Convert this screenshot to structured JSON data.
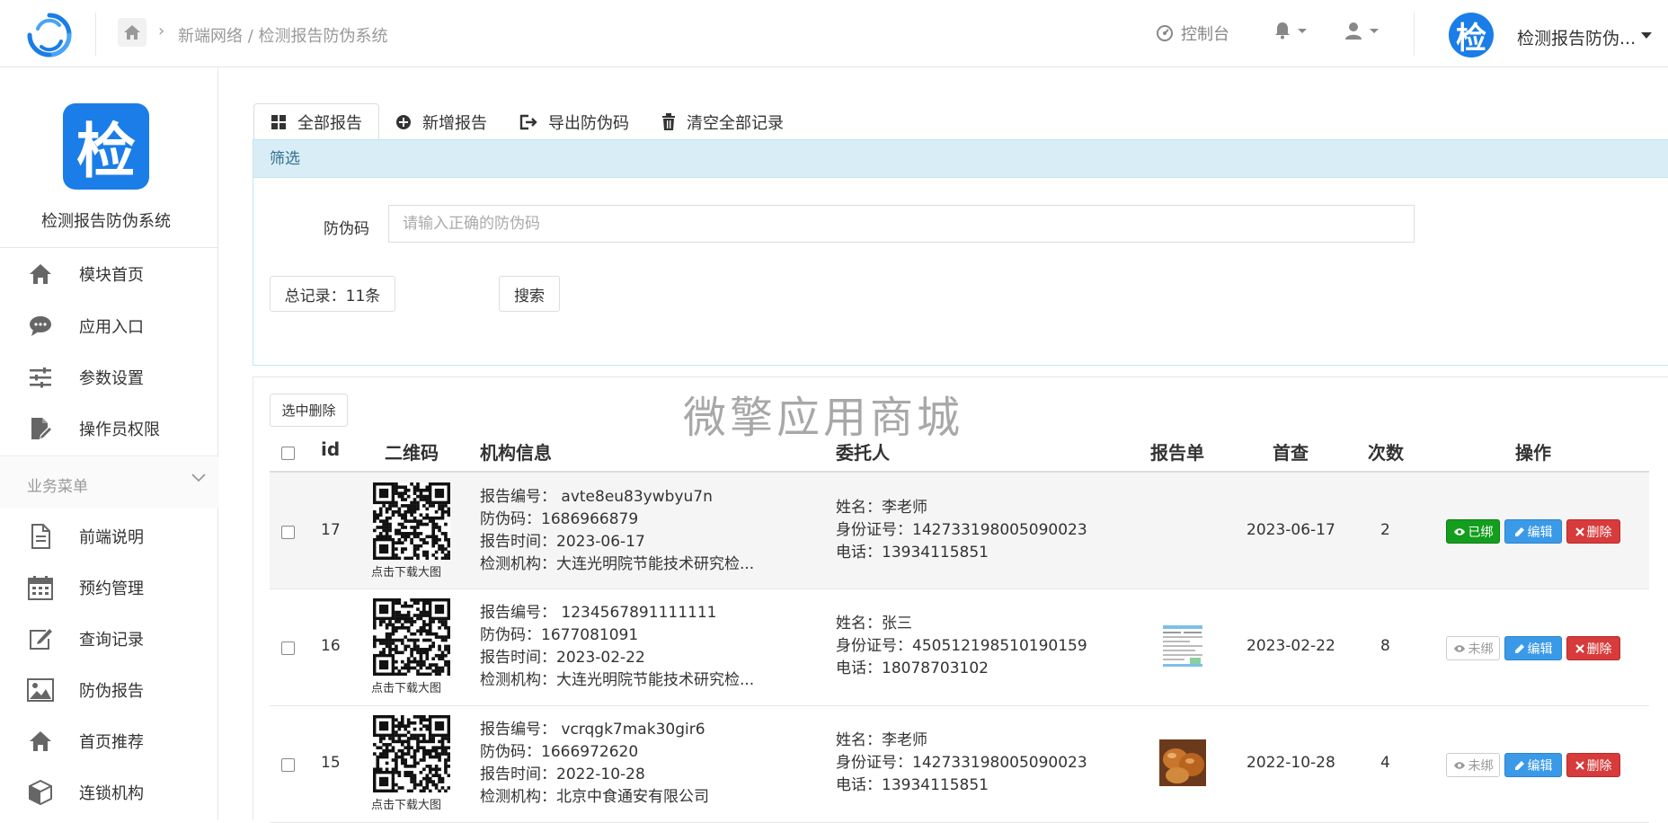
{
  "header": {
    "breadcrumb": "新端网络 / 检测报告防伪系统",
    "console_label": "控制台",
    "user_name": "检测报告防伪...",
    "avatar_glyph": "检"
  },
  "sidebar": {
    "logo_glyph": "检",
    "app_name": "检测报告防伪系统",
    "items": [
      {
        "label": "模块首页",
        "icon": "home-icon"
      },
      {
        "label": "应用入口",
        "icon": "chat-bubble-icon"
      },
      {
        "label": "参数设置",
        "icon": "sliders-icon"
      },
      {
        "label": "操作员权限",
        "icon": "edit-document-icon"
      }
    ],
    "group_label": "业务菜单",
    "group_items": [
      {
        "label": "前端说明",
        "icon": "document-icon"
      },
      {
        "label": "预约管理",
        "icon": "calendar-icon"
      },
      {
        "label": "查询记录",
        "icon": "pencil-square-icon"
      },
      {
        "label": "防伪报告",
        "icon": "image-icon"
      },
      {
        "label": "首页推荐",
        "icon": "home-icon"
      },
      {
        "label": "连锁机构",
        "icon": "cube-icon"
      }
    ]
  },
  "tabs": [
    {
      "label": "全部报告",
      "icon": "grid-icon"
    },
    {
      "label": "新增报告",
      "icon": "plus-circle-icon"
    },
    {
      "label": "导出防伪码",
      "icon": "export-icon"
    },
    {
      "label": "清空全部记录",
      "icon": "trash-icon"
    }
  ],
  "filter": {
    "title": "筛选",
    "field_label": "防伪码",
    "placeholder": "请输入正确的防伪码",
    "total": "总记录：11条",
    "search_label": "搜索"
  },
  "table": {
    "bulk_delete": "选中删除",
    "watermark": "微擎应用商城",
    "columns": [
      "id",
      "二维码",
      "机构信息",
      "委托人",
      "报告单",
      "首查",
      "次数",
      "操作"
    ],
    "qr_caption": "点击下载大图",
    "rows": [
      {
        "id": "17",
        "report_no": "报告编号：  avte8eu83ywbyu7n",
        "code": "防伪码：1686966879",
        "time": "报告时间：2023-06-17",
        "org": "检测机构：大连光明院节能技术研究检...",
        "name": "姓名：李老师",
        "idno": "身份证号：142733198005090023",
        "phone": "电话：13934115851",
        "report_img": "none",
        "first": "2023-06-17",
        "count": "2",
        "bind": "已绑",
        "bound": true
      },
      {
        "id": "16",
        "report_no": "报告编号：  1234567891111111",
        "code": "防伪码：1677081091",
        "time": "报告时间：2023-02-22",
        "org": "检测机构：大连光明院节能技术研究检...",
        "name": "姓名：张三",
        "idno": "身份证号：450512198510190159",
        "phone": "电话：18078703102",
        "report_img": "document",
        "first": "2023-02-22",
        "count": "8",
        "bind": "未绑",
        "bound": false
      },
      {
        "id": "15",
        "report_no": "报告编号：  vcrqgk7mak30gir6",
        "code": "防伪码：1666972620",
        "time": "报告时间：2022-10-28",
        "org": "检测机构：北京中食通安有限公司",
        "name": "姓名：李老师",
        "idno": "身份证号：142733198005090023",
        "phone": "电话：13934115851",
        "report_img": "food",
        "first": "2022-10-28",
        "count": "4",
        "bind": "未绑",
        "bound": false
      }
    ],
    "edit_label": "编辑",
    "delete_label": "删除"
  },
  "colors": {
    "brand": "#1a7de8",
    "filter_header": "#d9edf7",
    "bound_green": "#149e1e",
    "edit_blue": "#3a9ae8",
    "delete_red": "#d73b3b"
  }
}
